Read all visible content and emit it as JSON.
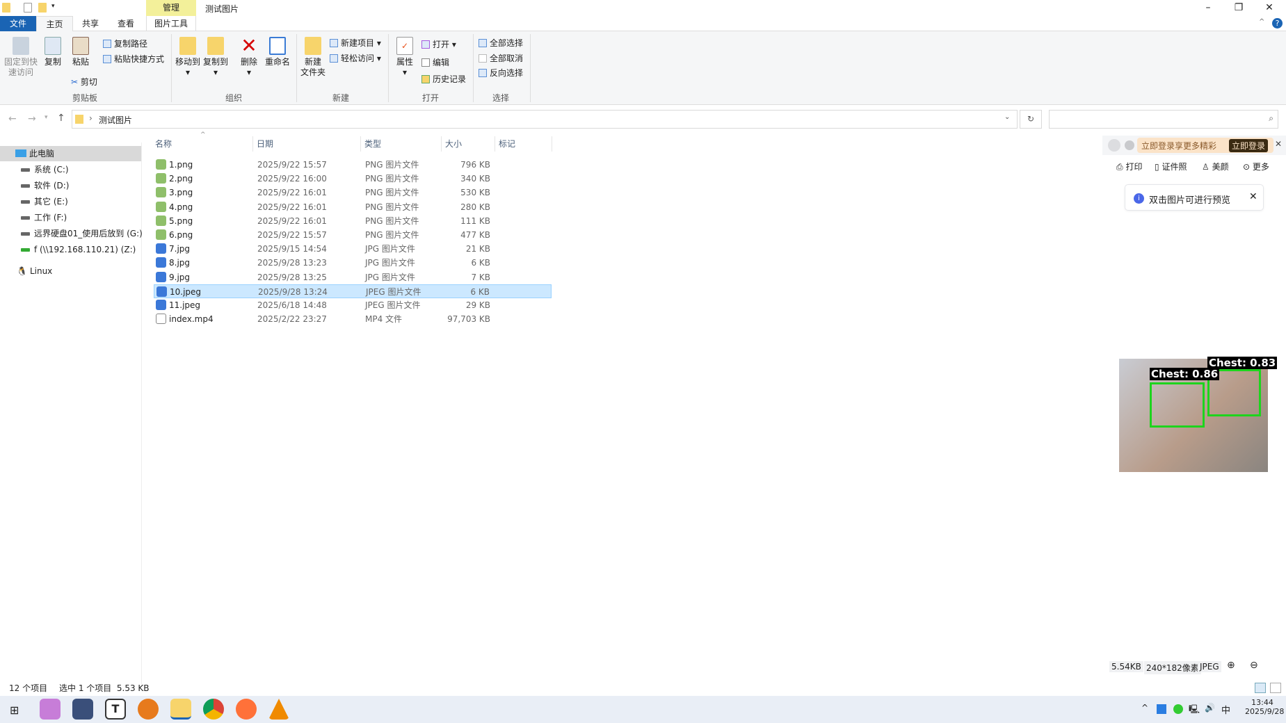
{
  "window": {
    "title": "测试图片",
    "context_tab": "管理"
  },
  "tabs": [
    "文件",
    "主页",
    "共享",
    "查看",
    "图片工具"
  ],
  "ribbon": {
    "clipboard": {
      "pin": "固定到快\n速访问",
      "copy": "复制",
      "paste": "粘贴",
      "copy_path": "复制路径",
      "paste_shortcut": "粘贴快捷方式",
      "cut": "剪切",
      "group": "剪贴板"
    },
    "organize": {
      "move_to": "移动到",
      "copy_to": "复制到",
      "delete": "删除",
      "rename": "重命名",
      "group": "组织"
    },
    "new": {
      "new_folder": "新建\n文件夹",
      "new_item": "新建项目",
      "easy_access": "轻松访问",
      "group": "新建"
    },
    "open": {
      "properties": "属性",
      "open": "打开",
      "edit": "编辑",
      "history": "历史记录",
      "group": "打开"
    },
    "select": {
      "select_all": "全部选择",
      "select_none": "全部取消",
      "invert": "反向选择",
      "group": "选择"
    }
  },
  "address": {
    "path": "测试图片",
    "search_placeholder": ""
  },
  "nav": {
    "items": [
      "此电脑",
      "系统 (C:)",
      "软件 (D:)",
      "其它 (E:)",
      "工作 (F:)",
      "远界硬盘01_使用后放到 (G:)",
      "f (\\\\192.168.110.21) (Z:)",
      "Linux"
    ]
  },
  "columns": [
    "名称",
    "日期",
    "类型",
    "大小",
    "标记"
  ],
  "files": [
    {
      "name": "1.png",
      "date": "2025/9/22 15:57",
      "type": "PNG 图片文件",
      "size": "796 KB",
      "kind": "png"
    },
    {
      "name": "2.png",
      "date": "2025/9/22 16:00",
      "type": "PNG 图片文件",
      "size": "340 KB",
      "kind": "png"
    },
    {
      "name": "3.png",
      "date": "2025/9/22 16:01",
      "type": "PNG 图片文件",
      "size": "530 KB",
      "kind": "png"
    },
    {
      "name": "4.png",
      "date": "2025/9/22 16:01",
      "type": "PNG 图片文件",
      "size": "280 KB",
      "kind": "png"
    },
    {
      "name": "5.png",
      "date": "2025/9/22 16:01",
      "type": "PNG 图片文件",
      "size": "111 KB",
      "kind": "png"
    },
    {
      "name": "6.png",
      "date": "2025/9/22 15:57",
      "type": "PNG 图片文件",
      "size": "477 KB",
      "kind": "png"
    },
    {
      "name": "7.jpg",
      "date": "2025/9/15 14:54",
      "type": "JPG 图片文件",
      "size": "21 KB",
      "kind": "jpg"
    },
    {
      "name": "8.jpg",
      "date": "2025/9/28 13:23",
      "type": "JPG 图片文件",
      "size": "6 KB",
      "kind": "jpg"
    },
    {
      "name": "9.jpg",
      "date": "2025/9/28 13:25",
      "type": "JPG 图片文件",
      "size": "7 KB",
      "kind": "jpg"
    },
    {
      "name": "10.jpeg",
      "date": "2025/9/28 13:24",
      "type": "JPEG 图片文件",
      "size": "6 KB",
      "kind": "jpg",
      "selected": true
    },
    {
      "name": "11.jpeg",
      "date": "2025/6/18 14:48",
      "type": "JPEG 图片文件",
      "size": "29 KB",
      "kind": "jpg"
    },
    {
      "name": "index.mp4",
      "date": "2025/2/22 23:27",
      "type": "MP4 文件",
      "size": "97,703 KB",
      "kind": "mp4"
    }
  ],
  "panel": {
    "promo": "立即登录享更多精彩",
    "login": "立即登录",
    "tools": [
      "打印",
      "证件照",
      "美颜",
      "更多"
    ],
    "tip": "双击图片可进行预览",
    "detections": [
      "Chest: 0.86",
      "Chest: 0.83"
    ],
    "info": {
      "size": "5.54KB",
      "dims": "240*182像素",
      "format": "JPEG"
    }
  },
  "status": {
    "count": "12 个项目",
    "selected": "选中 1 个项目  5.53 KB"
  },
  "taskbar": {
    "time": "13:44",
    "date": "2025/9/28",
    "ime": "中"
  }
}
